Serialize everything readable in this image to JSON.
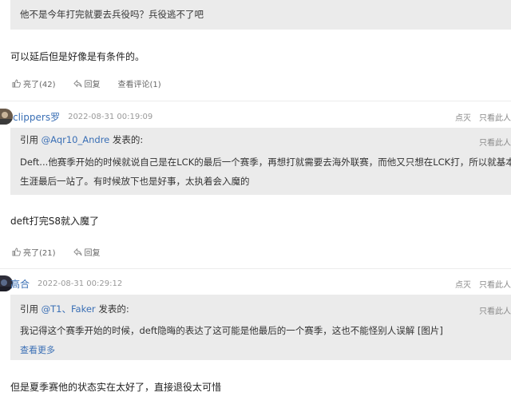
{
  "comment0": {
    "quote_text": "他不是今年打完就要去兵役吗？兵役逃不了吧",
    "body": "可以延后但是好像是有条件的。",
    "like": "亮了(42)",
    "reply": "回复",
    "view_thread": "查看评论(1)"
  },
  "comment1": {
    "username": "clippers罗",
    "timestamp": "2022-08-31 00:19:09",
    "dim": "点灭",
    "only_him": "只看此人",
    "quote": {
      "prefix": "引用 ",
      "user": "@Aqr10_Andre",
      "suffix": " 发表的:",
      "only_him": "只看此人",
      "line1": "Deft...他赛季开始的时候就说自己是在LCK的最后一个赛季，再想打就需要去海外联赛，而他又只想在LCK打，所以就基本上是",
      "line2": "生涯最后一站了。有时候放下也是好事，太执着会入魔的"
    },
    "body": "deft打完S8就入魔了",
    "like": "亮了(21)",
    "reply": "回复"
  },
  "comment2": {
    "username": "高合",
    "timestamp": "2022-08-31 00:29:12",
    "dim": "点灭",
    "only_him": "只看此人",
    "quote": {
      "prefix": "引用 ",
      "user": "@T1、Faker",
      "suffix": " 发表的:",
      "only_him": "只看此人",
      "line1": "我记得这个赛季开始的时候，deft隐晦的表达了这可能是他最后的一个赛季，这也不能怪别人误解 [图片]",
      "more": "查看更多"
    },
    "body": "但是夏季赛他的状态实在太好了，直接退役太可惜"
  },
  "colors": {
    "link": "#3a6fb5",
    "quote_bg": "#ebebeb",
    "muted": "#888888"
  }
}
